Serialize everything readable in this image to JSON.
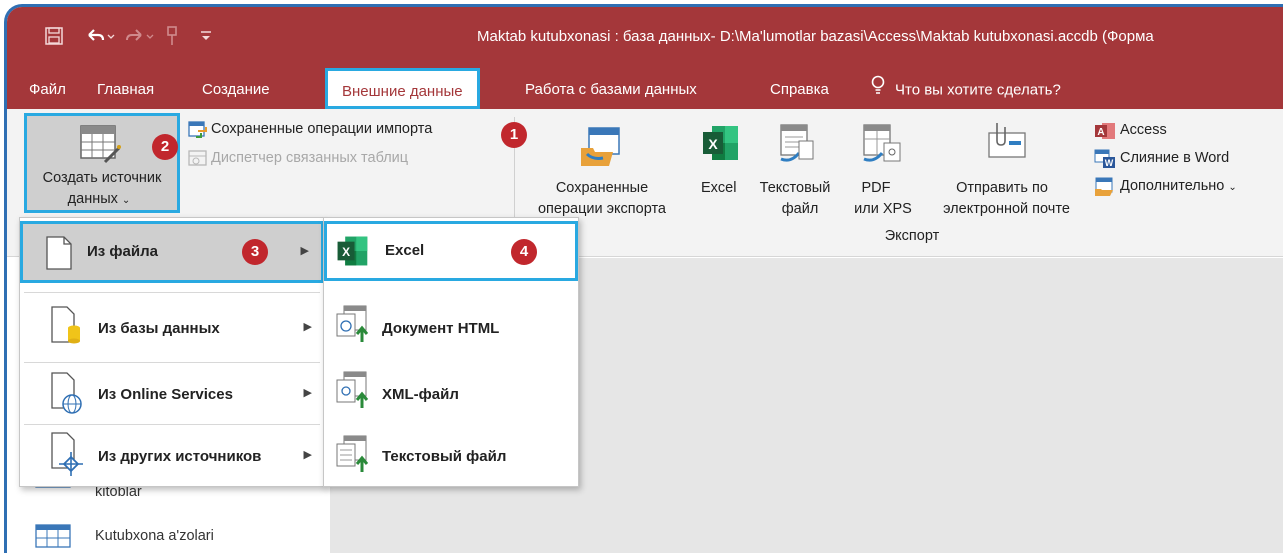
{
  "window": {
    "title": "Maktab kutubxonasi : база данных- D:\\Ma'lumotlar bazasi\\Access\\Maktab kutubxonasi.accdb (Форма",
    "quick_access": [
      "save-icon",
      "undo-icon",
      "redo-icon",
      "pin-icon",
      "customize-icon"
    ]
  },
  "tabs": [
    {
      "label": "Файл"
    },
    {
      "label": "Главная"
    },
    {
      "label": "Создание"
    },
    {
      "label": "Внешние данные",
      "active": true
    },
    {
      "label": "Работа с базами данных"
    },
    {
      "label": "Справка"
    },
    {
      "label": "Что вы хотите сделать?",
      "icon": "lightbulb-icon"
    }
  ],
  "ribbon": {
    "import_group": {
      "create_source_line1": "Создать источник",
      "create_source_line2": "данных",
      "saved_imports": "Сохраненные операции импорта",
      "linked_table_manager": "Диспетчер связанных таблиц"
    },
    "export_group": {
      "saved_exports_line1": "Сохраненные",
      "saved_exports_line2": "операции экспорта",
      "excel": "Excel",
      "text_file_line1": "Текстовый",
      "text_file_line2": "файл",
      "pdf_line1": "PDF",
      "pdf_line2": "или XPS",
      "email_line1": "Отправить по",
      "email_line2": "электронной почте",
      "access": "Access",
      "word_merge": "Слияние в Word",
      "more": "Дополнительно",
      "group_label": "Экспорт"
    }
  },
  "badges": {
    "b1": "1",
    "b2": "2",
    "b3": "3",
    "b4": "4"
  },
  "menu_sources": [
    {
      "label": "Из файла",
      "selected": true
    },
    {
      "label": "Из базы данных"
    },
    {
      "label": "Из Online Services"
    },
    {
      "label": "Из других источников"
    }
  ],
  "menu_file_types": [
    {
      "label": "Excel",
      "selected": true
    },
    {
      "label": "Документ HTML"
    },
    {
      "label": "XML-файл"
    },
    {
      "label": "Текстовый файл"
    }
  ],
  "nav_pane": {
    "items": [
      "kitoblar",
      "Kutubxona a'zolari"
    ]
  },
  "colors": {
    "access_red": "#a4373a",
    "highlight_blue": "#29a9e1",
    "badge_red": "#c1272d",
    "frame_blue": "#2f6fb3"
  }
}
